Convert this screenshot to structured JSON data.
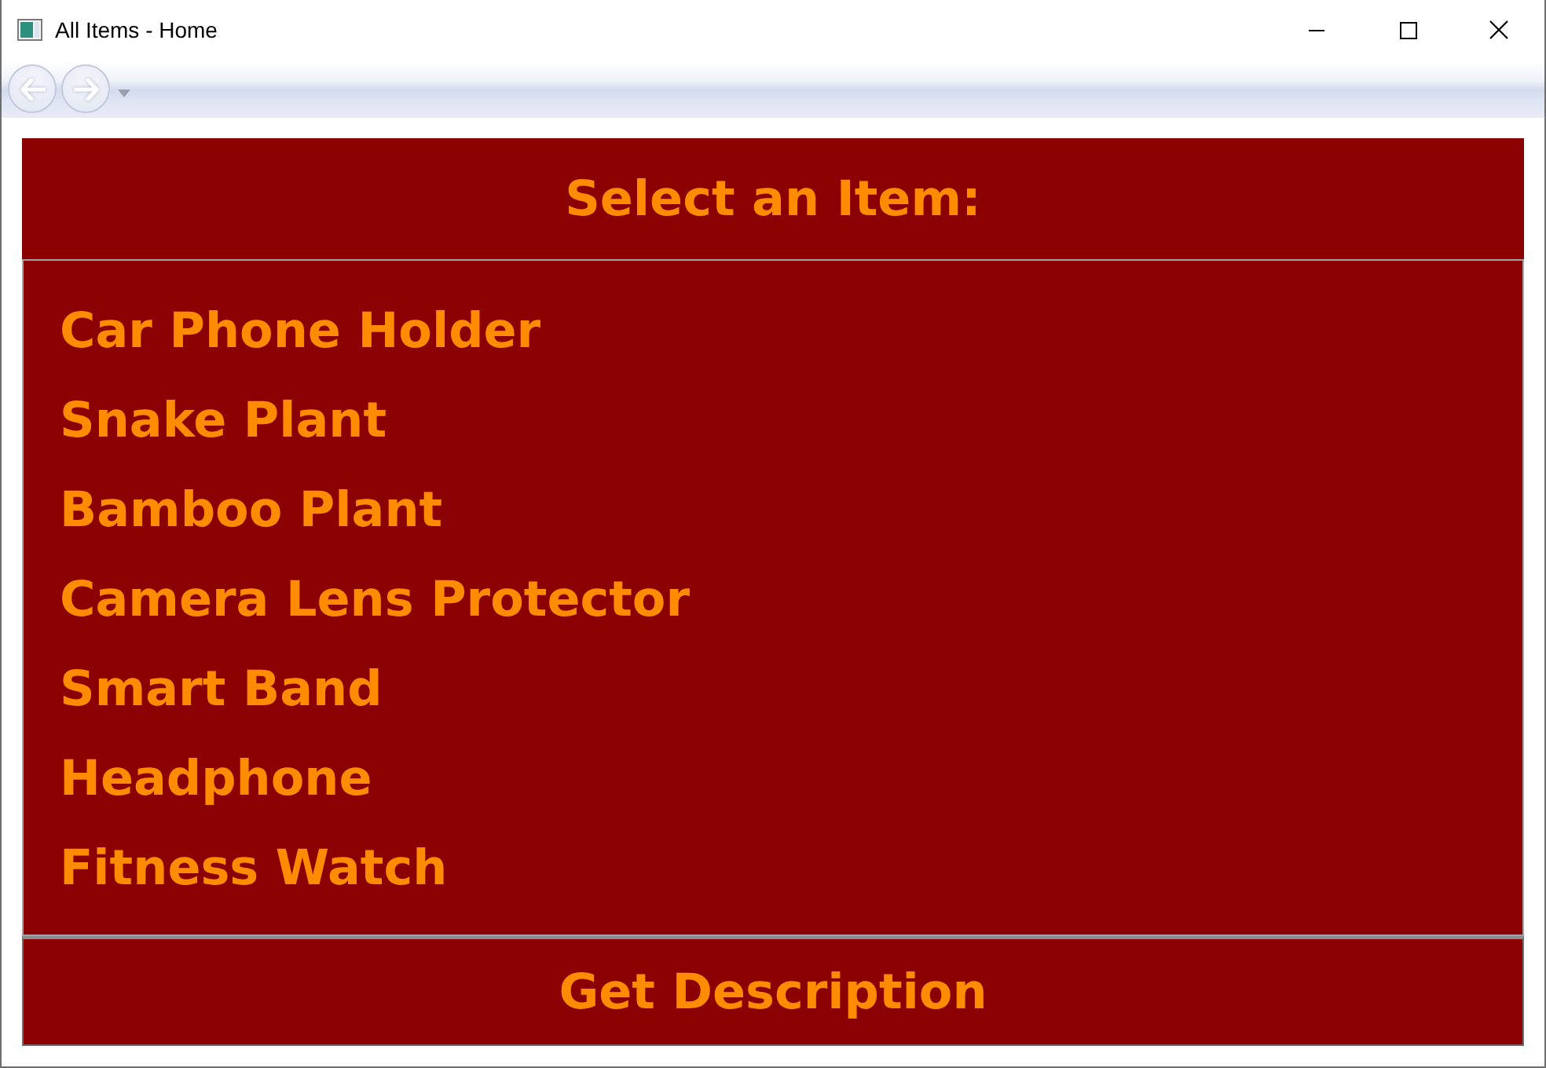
{
  "window": {
    "title": "All Items - Home"
  },
  "navigation": {
    "back": {
      "disabled": true
    },
    "forward": {
      "disabled": true
    }
  },
  "heading": "Select an Item:",
  "items": [
    {
      "label": "Car Phone Holder",
      "selected": false
    },
    {
      "label": "Snake Plant",
      "selected": false
    },
    {
      "label": "Bamboo Plant",
      "selected": false
    },
    {
      "label": "Camera Lens Protector",
      "selected": false
    },
    {
      "label": "Smart Band",
      "selected": false
    },
    {
      "label": "Headphone",
      "selected": false
    },
    {
      "label": "Fitness Watch",
      "selected": false
    }
  ],
  "button": "Get Description"
}
